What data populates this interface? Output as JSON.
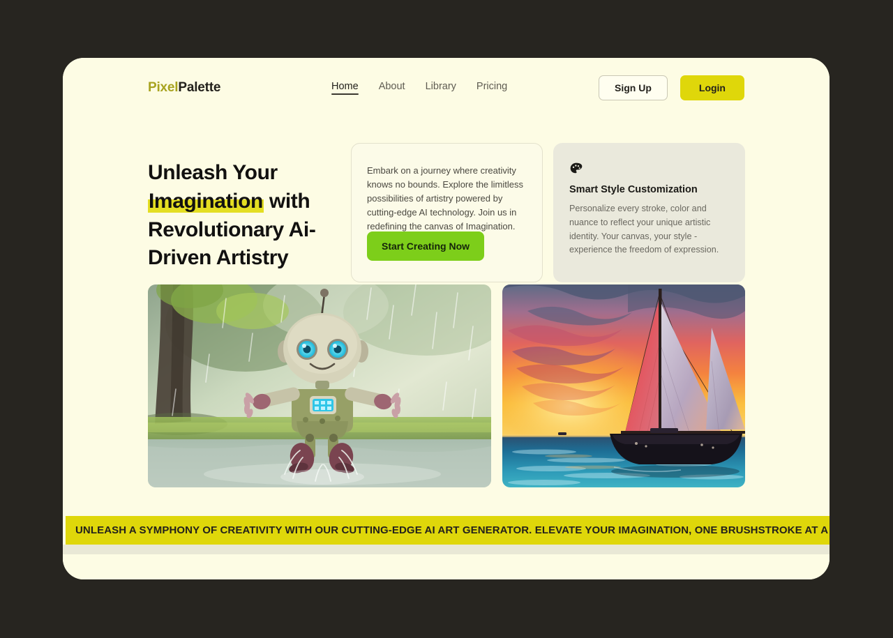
{
  "window": {
    "background_color": "#FDFCE4",
    "page_background_color": "#272520"
  },
  "header": {
    "logo": {
      "first": "Pixel",
      "second": "Palette",
      "first_color": "#A8A320",
      "second_color": "#23211C"
    },
    "nav": [
      {
        "label": "Home",
        "active": true
      },
      {
        "label": "About",
        "active": false
      },
      {
        "label": "Library",
        "active": false
      },
      {
        "label": "Pricing",
        "active": false
      }
    ],
    "signup_label": "Sign Up",
    "login_label": "Login",
    "login_color": "#DFD70A"
  },
  "hero": {
    "headline_part1": "Unleash Your",
    "headline_highlight": "Imagination",
    "headline_part2": " with Revolutionary Ai-Driven Artistry",
    "highlight_color": "#E4DE22",
    "description_card": {
      "body": "Embark on a journey where creativity knows no bounds. Explore the limitless possibilities of artistry powered by cutting-edge AI technology. Join us in redefining the canvas of Imagination.",
      "cta_label": "Start Creating Now",
      "cta_color": "#7DCE1A"
    },
    "feature_card": {
      "icon": "palette-icon",
      "title": "Smart Style Customization",
      "body": "Personalize every stroke, color and nuance to reflect your unique artistic identity. Your canvas, your style - experience the freedom of expression.",
      "background_color": "#EAE9DC"
    }
  },
  "gallery": {
    "items": [
      {
        "name": "robot-in-rain-artwork",
        "alt": "Cute green robot jumping in a rain puddle in a forest"
      },
      {
        "name": "sailboat-sunset-artwork",
        "alt": "Watercolor sailboat on the ocean at sunset"
      }
    ]
  },
  "ticker": {
    "text": "UNLEASH A SYMPHONY OF CREATIVITY WITH OUR CUTTING-EDGE AI ART GENERATOR. ELEVATE YOUR IMAGINATION, ONE BRUSHSTROKE AT A TIME.",
    "background_color": "#DFD70A"
  }
}
